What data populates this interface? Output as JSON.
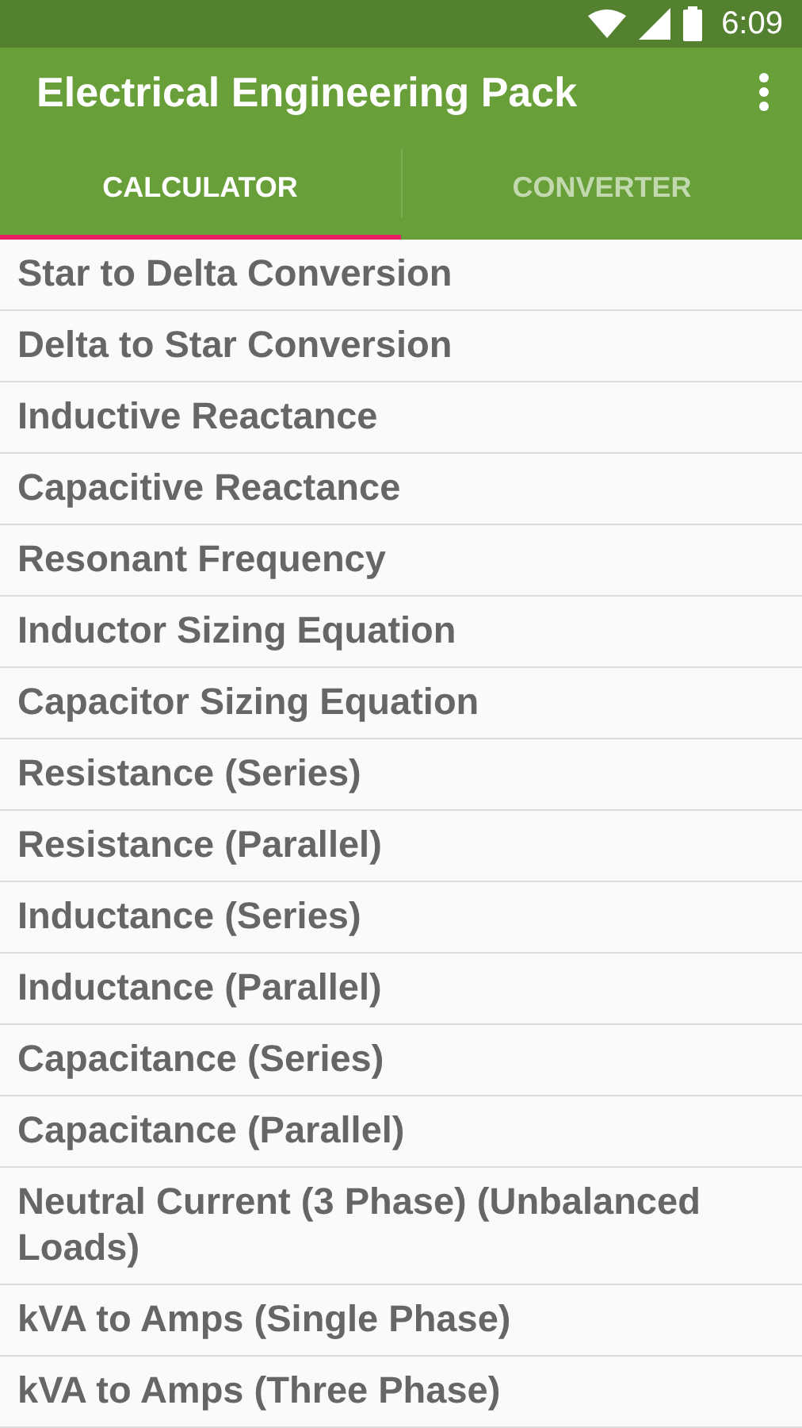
{
  "status_bar": {
    "time": "6:09"
  },
  "app_bar": {
    "title": "Electrical Engineering Pack"
  },
  "tabs": [
    {
      "label": "CALCULATOR",
      "selected": true
    },
    {
      "label": "CONVERTER",
      "selected": false
    }
  ],
  "items": [
    "Star to Delta Conversion",
    "Delta to Star Conversion",
    "Inductive Reactance",
    "Capacitive Reactance",
    "Resonant Frequency",
    "Inductor Sizing Equation",
    "Capacitor Sizing Equation",
    "Resistance (Series)",
    "Resistance (Parallel)",
    "Inductance (Series)",
    "Inductance (Parallel)",
    "Capacitance (Series)",
    "Capacitance (Parallel)",
    "Neutral Current (3 Phase) (Unbalanced Loads)",
    "kVA to Amps (Single Phase)",
    "kVA to Amps (Three Phase)"
  ]
}
